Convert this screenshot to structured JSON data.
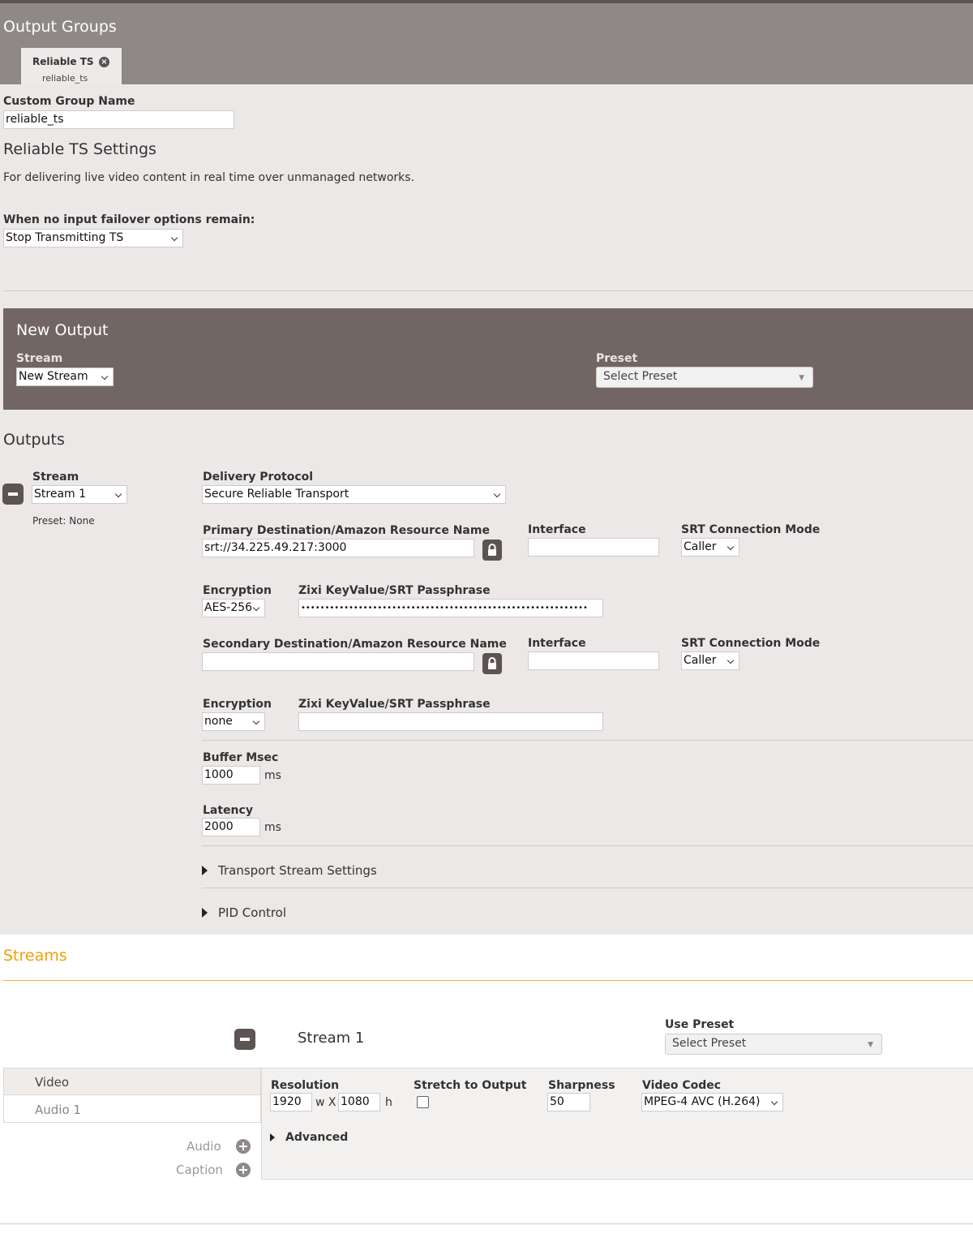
{
  "output_groups": {
    "title": "Output Groups",
    "tab": {
      "name": "Reliable TS",
      "sub": "reliable_ts"
    }
  },
  "group": {
    "custom_name_label": "Custom Group Name",
    "custom_name_value": "reliable_ts",
    "settings_title": "Reliable TS Settings",
    "description": "For delivering live video content in real time over unmanaged networks.",
    "failover_label": "When no input failover options remain:",
    "failover_value": "Stop Transmitting TS"
  },
  "new_output": {
    "title": "New Output",
    "stream_label": "Stream",
    "stream_value": "New Stream",
    "preset_label": "Preset",
    "preset_value": "Select Preset"
  },
  "outputs": {
    "title": "Outputs",
    "stream_label": "Stream",
    "stream_value": "Stream 1",
    "preset_info": "Preset: None",
    "delivery_protocol_label": "Delivery Protocol",
    "delivery_protocol_value": "Secure Reliable Transport",
    "primary": {
      "dest_label": "Primary Destination/Amazon Resource Name",
      "dest_value": "srt://34.225.49.217:3000",
      "interface_label": "Interface",
      "interface_value": "",
      "mode_label": "SRT Connection Mode",
      "mode_value": "Caller",
      "encryption_label": "Encryption",
      "encryption_value": "AES-256",
      "passphrase_label": "Zixi KeyValue/SRT Passphrase",
      "passphrase_value": "••••••••••••••••••••••••••••••••••••••••••••••••••••••••••••"
    },
    "secondary": {
      "dest_label": "Secondary Destination/Amazon Resource Name",
      "dest_value": "",
      "interface_label": "Interface",
      "interface_value": "",
      "mode_label": "SRT Connection Mode",
      "mode_value": "Caller",
      "encryption_label": "Encryption",
      "encryption_value": "none",
      "passphrase_label": "Zixi KeyValue/SRT Passphrase",
      "passphrase_value": ""
    },
    "buffer_label": "Buffer Msec",
    "buffer_value": "1000",
    "buffer_unit": "ms",
    "latency_label": "Latency",
    "latency_value": "2000",
    "latency_unit": "ms",
    "ts_settings": "Transport Stream Settings",
    "pid_control": "PID Control"
  },
  "streams": {
    "title": "Streams",
    "title_color": "#f0a000",
    "stream_name": "Stream 1",
    "use_preset_label": "Use Preset",
    "use_preset_value": "Select Preset",
    "tabs": [
      "Video",
      "Audio 1"
    ],
    "add_audio": "Audio",
    "add_caption": "Caption",
    "video": {
      "resolution_label": "Resolution",
      "width": "1920",
      "width_unit": "w X",
      "height": "1080",
      "height_unit": "h",
      "stretch_label": "Stretch to Output",
      "sharpness_label": "Sharpness",
      "sharpness_value": "50",
      "codec_label": "Video Codec",
      "codec_value": "MPEG-4 AVC (H.264)",
      "advanced": "Advanced"
    }
  }
}
